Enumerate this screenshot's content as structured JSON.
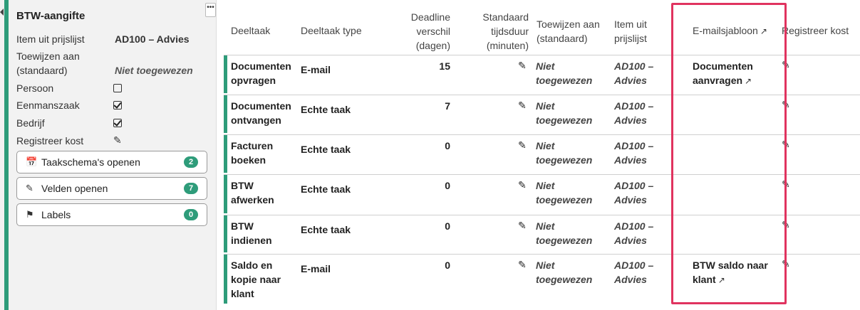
{
  "panel": {
    "title": "BTW-aangifte",
    "more_label": "•••",
    "props": [
      {
        "label": "Item uit prijslijst",
        "value": "AD100 – Advies"
      },
      {
        "label": "Toewijzen aan (standaard)",
        "value": "Niet toegewezen"
      },
      {
        "label": "Persoon",
        "checked": false
      },
      {
        "label": "Eenmanszaak",
        "checked": true
      },
      {
        "label": "Bedrijf",
        "checked": true
      },
      {
        "label": "Registreer kost",
        "icon": "pencil-icon"
      }
    ],
    "buttons": [
      {
        "label": "Taakschema's openen",
        "count": "2",
        "icon": "calendar-icon"
      },
      {
        "label": "Velden openen",
        "count": "7",
        "icon": "edit-square-icon"
      },
      {
        "label": "Labels",
        "count": "0",
        "icon": "tags-icon"
      }
    ]
  },
  "table": {
    "headers": {
      "deeltaak": "Deeltaak",
      "type": "Deeltaak type",
      "deadline": [
        "Deadline",
        "verschil",
        "(dagen)"
      ],
      "duur": [
        "Standaard",
        "tijdsduur",
        "(minuten)"
      ],
      "toewijzen": [
        "Toewijzen aan",
        "(standaard)"
      ],
      "item": [
        "Item uit",
        "prijslijst"
      ],
      "email": "E-mailsjabloon",
      "kost": "Registreer kost"
    },
    "rows": [
      {
        "name": [
          "Documenten",
          "opvragen"
        ],
        "type": "E-mail",
        "deadline": "15",
        "toewijzen": [
          "Niet",
          "toegewezen"
        ],
        "item": [
          "AD100 –",
          "Advies"
        ],
        "email": [
          "Documenten",
          "aanvragen"
        ]
      },
      {
        "name": [
          "Documenten",
          "ontvangen"
        ],
        "type": "Echte taak",
        "deadline": "7",
        "toewijzen": [
          "Niet",
          "toegewezen"
        ],
        "item": [
          "AD100 –",
          "Advies"
        ],
        "email": []
      },
      {
        "name": [
          "Facturen",
          "boeken"
        ],
        "type": "Echte taak",
        "deadline": "0",
        "toewijzen": [
          "Niet",
          "toegewezen"
        ],
        "item": [
          "AD100 –",
          "Advies"
        ],
        "email": []
      },
      {
        "name": [
          "BTW",
          "afwerken"
        ],
        "type": "Echte taak",
        "deadline": "0",
        "toewijzen": [
          "Niet",
          "toegewezen"
        ],
        "item": [
          "AD100 –",
          "Advies"
        ],
        "email": []
      },
      {
        "name": [
          "BTW",
          "indienen"
        ],
        "type": "Echte taak",
        "deadline": "0",
        "toewijzen": [
          "Niet",
          "toegewezen"
        ],
        "item": [
          "AD100 –",
          "Advies"
        ],
        "email": []
      },
      {
        "name": [
          "Saldo en",
          "kopie naar",
          "klant"
        ],
        "type": "E-mail",
        "deadline": "0",
        "toewijzen": [
          "Niet",
          "toegewezen"
        ],
        "item": [
          "AD100 –",
          "Advies"
        ],
        "email": [
          "BTW saldo naar",
          "klant"
        ]
      }
    ]
  },
  "colors": {
    "accent": "#2e9c7a",
    "highlight": "#e0335f"
  }
}
